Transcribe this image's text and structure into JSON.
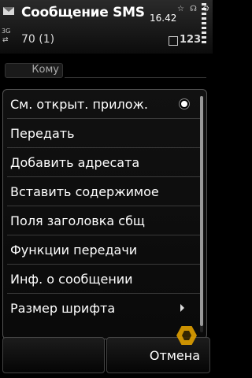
{
  "status_bar": {
    "title": "Сообщение SMS",
    "time": "16.42",
    "network": "3G",
    "network_arrows": "⇄",
    "char_counter": "70 (1)",
    "input_mode": "123",
    "top_icons": "☆ ☊ ⚙"
  },
  "recipient": {
    "to_label": "Кому"
  },
  "menu": {
    "items": [
      {
        "label": "См. открыт. прилож.",
        "marker": "radio-selected"
      },
      {
        "label": "Передать"
      },
      {
        "label": "Добавить адресата"
      },
      {
        "label": "Вставить содержимое"
      },
      {
        "label": "Поля заголовка сбщ"
      },
      {
        "label": "Функции передачи"
      },
      {
        "label": "Инф. о сообщении"
      },
      {
        "label": "Размер шрифта",
        "marker": "submenu-arrow"
      }
    ]
  },
  "softkeys": {
    "left": "",
    "right": "Отмена"
  },
  "colors": {
    "background": "#000000",
    "menu_border": "#555555",
    "logo": "#e0a000"
  }
}
